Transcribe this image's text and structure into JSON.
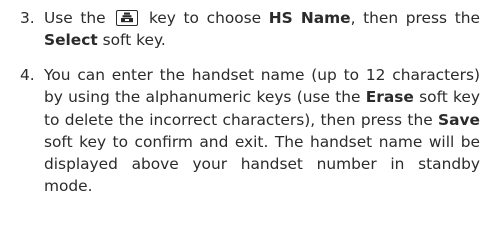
{
  "steps": [
    {
      "number": "3.",
      "parts": {
        "a": "Use the",
        "b": "key to choose",
        "c": "HS Name",
        "d": ", then press the",
        "e": "Select",
        "f": "soft key."
      },
      "icon": "phonebook-key-icon"
    },
    {
      "number": "4.",
      "parts": {
        "a": "You can enter the handset name (up to 12 characters) by using the alphanumeric keys (use the",
        "b": "Erase",
        "c": "soft key to delete the incorrect characters), then press the",
        "d": "Save",
        "e": "soft key to confirm and exit. The handset name will be displayed above your handset number in standby mode."
      }
    }
  ]
}
